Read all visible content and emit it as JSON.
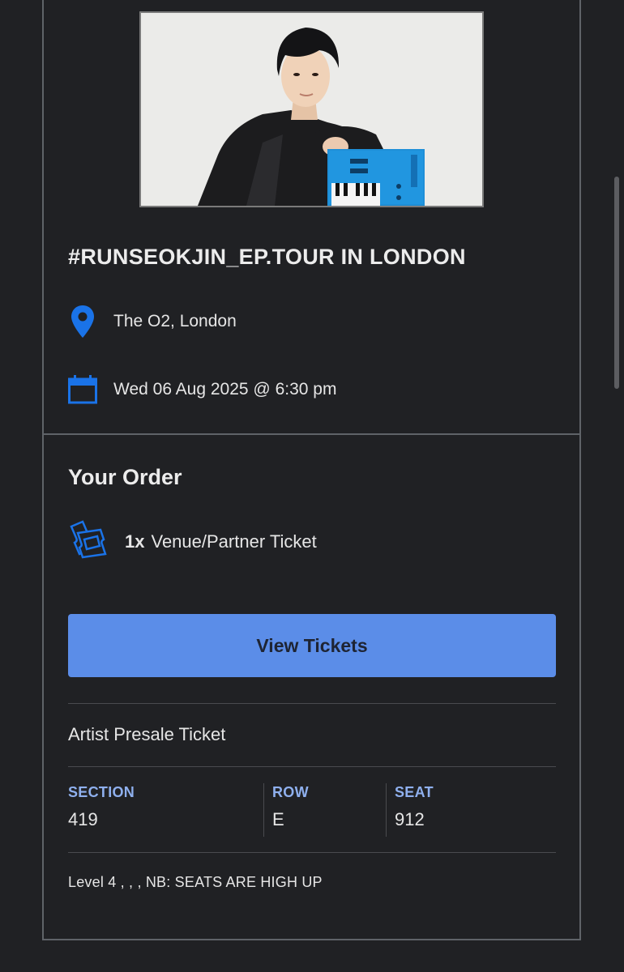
{
  "event": {
    "title": "#RUNSEOKJIN_EP.TOUR IN LONDON",
    "venue": "The O2, London",
    "datetime": "Wed 06 Aug 2025 @ 6:30 pm",
    "image_alt": "Artist promotional photo with blue keyboard"
  },
  "order": {
    "title": "Your Order",
    "quantity": "1x",
    "ticket_type": "Venue/Partner Ticket",
    "view_button": "View Tickets"
  },
  "ticket": {
    "category": "Artist Presale Ticket",
    "section_label": "SECTION",
    "section_value": "419",
    "row_label": "ROW",
    "row_value": "E",
    "seat_label": "SEAT",
    "seat_value": "912",
    "note": "Level 4 , , , NB: SEATS ARE HIGH UP"
  },
  "icons": {
    "location": "location-pin-icon",
    "calendar": "calendar-icon",
    "ticket": "tickets-icon"
  },
  "colors": {
    "background": "#202124",
    "accent": "#5b8de8",
    "icon_blue": "#1a73e8",
    "label_blue": "#8fb0ee"
  }
}
